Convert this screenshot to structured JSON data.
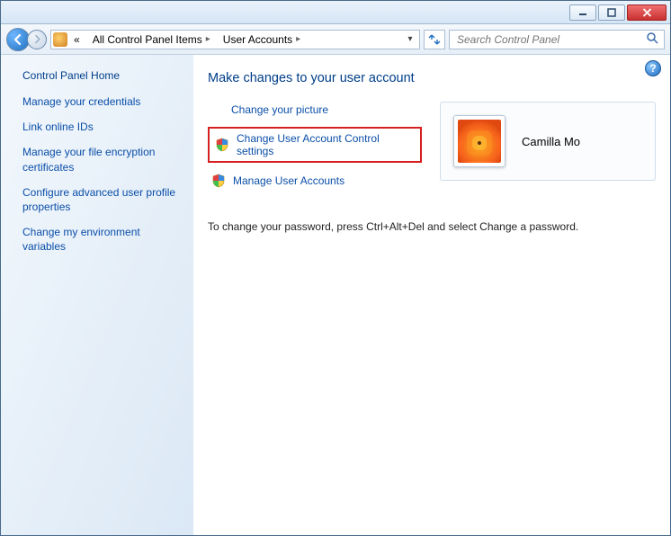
{
  "breadcrumb": {
    "overflow": "«",
    "items": [
      "All Control Panel Items",
      "User Accounts"
    ]
  },
  "search": {
    "placeholder": "Search Control Panel"
  },
  "sidebar": {
    "home": "Control Panel Home",
    "links": [
      "Manage your credentials",
      "Link online IDs",
      "Manage your file encryption certificates",
      "Configure advanced user profile properties",
      "Change my environment variables"
    ]
  },
  "main": {
    "heading": "Make changes to your user account",
    "tasks": [
      {
        "label": "Change your picture",
        "shield": false,
        "highlight": false
      },
      {
        "label": "Change User Account Control settings",
        "shield": true,
        "highlight": true
      },
      {
        "label": "Manage User Accounts",
        "shield": true,
        "highlight": false
      }
    ],
    "user": {
      "name": "Camilla Mo"
    },
    "instruction": "To change your password, press Ctrl+Alt+Del and select Change a password."
  }
}
